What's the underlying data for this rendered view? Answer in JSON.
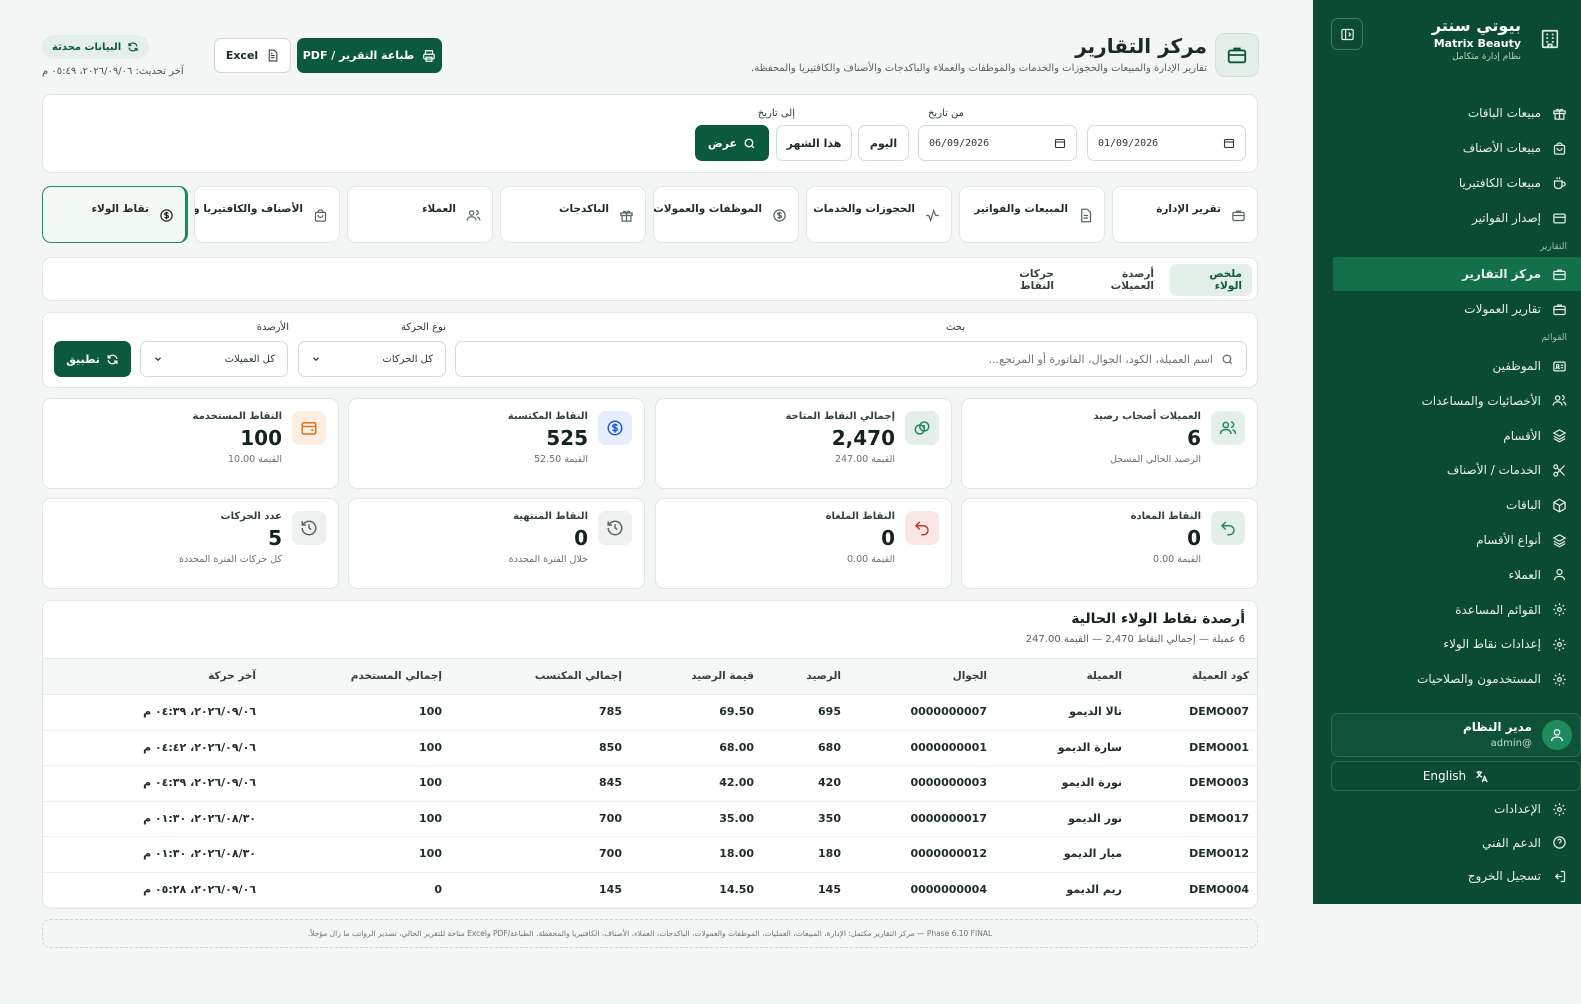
{
  "sidebar": {
    "brand_title": "بيوتي سنتر",
    "brand_name": "Matrix Beauty",
    "brand_tagline": "نظام إدارة متكامل",
    "items_top": [
      {
        "label": "مبيعات الباقات",
        "icon": "gift-icon"
      },
      {
        "label": "مبيعات الأصناف",
        "icon": "bag-icon"
      },
      {
        "label": "مبيعات الكافتيريا",
        "icon": "cup-icon"
      },
      {
        "label": "إصدار الفواتير",
        "icon": "card-icon"
      }
    ],
    "section_reports": "التقارير",
    "items_reports": [
      {
        "label": "مركز التقارير",
        "icon": "briefcase-icon",
        "active": true
      },
      {
        "label": "تقارير العمولات",
        "icon": "briefcase-icon"
      }
    ],
    "section_lists": "القوائم",
    "items_lists": [
      {
        "label": "الموظفين",
        "icon": "id-card-icon"
      },
      {
        "label": "الأخصائيات والمساعدات",
        "icon": "users-icon"
      },
      {
        "label": "الأقسام",
        "icon": "layers-icon"
      },
      {
        "label": "الخدمات / الأصناف",
        "icon": "scissors-icon"
      },
      {
        "label": "الباقات",
        "icon": "box-icon"
      },
      {
        "label": "أنواع الأقسام",
        "icon": "layers-icon"
      },
      {
        "label": "العملاء",
        "icon": "user-icon"
      },
      {
        "label": "القوائم المساعدة",
        "icon": "gear-icon"
      },
      {
        "label": "إعدادات نقاط الولاء",
        "icon": "gear-icon"
      },
      {
        "label": "المستخدمون والصلاحيات",
        "icon": "gear-icon"
      }
    ],
    "user_name": "مدير النظام",
    "user_handle": "@admin",
    "language_label": "English",
    "items_bottom": [
      {
        "label": "الإعدادات",
        "icon": "gear-icon"
      },
      {
        "label": "الدعم الفني",
        "icon": "help-icon"
      },
      {
        "label": "تسجيل الخروج",
        "icon": "logout-icon"
      }
    ]
  },
  "header": {
    "title": "مركز التقارير",
    "subtitle": "تقارير الإدارة والمبيعات والحجوزات والخدمات والموظفات والعملاء والباكدجات والأصناف والكافتيريا والمحفظة.",
    "print_button": "طباعة التقرير / PDF",
    "excel_button": "Excel",
    "updated_badge": "البيانات محدثة",
    "last_update": "آخر تحديث: ٢٠٢٦/٠٩/٠٦، ٠٥:٤٩ م"
  },
  "filters": {
    "from_label": "من تاريخ",
    "from_value": "01/09/2026",
    "to_label": "إلى تاريخ",
    "to_value": "06/09/2026",
    "today_button": "اليوم",
    "month_button": "هذا الشهر",
    "show_button": "عرض"
  },
  "report_tabs": [
    {
      "label": "تقرير الإدارة",
      "icon": "briefcase-icon"
    },
    {
      "label": "المبيعات والفواتير",
      "icon": "document-icon"
    },
    {
      "label": "الحجوزات والخدمات",
      "icon": "activity-icon"
    },
    {
      "label": "الموظفات والعمولات",
      "icon": "dollar-icon"
    },
    {
      "label": "الباكدجات",
      "icon": "gift-icon"
    },
    {
      "label": "العملاء",
      "icon": "users-icon"
    },
    {
      "label": "الأصناف والكافتيريا والمحفظة",
      "icon": "bag-icon"
    },
    {
      "label": "نقاط الولاء",
      "icon": "dollar-icon",
      "active": true
    }
  ],
  "sub_tabs": [
    {
      "label": "ملخص الولاء",
      "active": true
    },
    {
      "label": "أرصدة العميلات"
    },
    {
      "label": "حركات النقاط"
    }
  ],
  "search": {
    "search_label": "بحث",
    "search_placeholder": "اسم العميلة، الكود، الجوال، الفاتورة أو المرتجع...",
    "movement_label": "نوع الحركة",
    "movement_value": "كل الحركات",
    "balance_label": "الأرصدة",
    "balance_value": "كل العميلات",
    "apply_button": "تطبيق"
  },
  "stats": [
    {
      "title": "العميلات أصحاب رصيد",
      "value": "6",
      "note": "الرصيد الحالي المسجل",
      "icon": "users-icon",
      "accent": "#1f8a5c"
    },
    {
      "title": "إجمالي النقاط المتاحة",
      "value": "2,470",
      "note": "القيمة 247.00",
      "icon": "coins-icon",
      "accent": "#1f8a5c"
    },
    {
      "title": "النقاط المكتسبة",
      "value": "525",
      "note": "القيمة 52.50",
      "icon": "dollar-icon",
      "accent": "#1d5fd1"
    },
    {
      "title": "النقاط المستخدمة",
      "value": "100",
      "note": "القيمة 10.00",
      "icon": "wallet-icon",
      "accent": "#d9731c"
    },
    {
      "title": "النقاط المعادة",
      "value": "0",
      "note": "القيمة 0.00",
      "icon": "undo-icon",
      "accent": "#1f8a5c"
    },
    {
      "title": "النقاط الملغاة",
      "value": "0",
      "note": "القيمة 0.00",
      "icon": "undo-icon",
      "accent": "#c0392b"
    },
    {
      "title": "النقاط المنتهية",
      "value": "0",
      "note": "خلال الفترة المحددة",
      "icon": "history-icon",
      "accent": "#5b6761"
    },
    {
      "title": "عدد الحركات",
      "value": "5",
      "note": "كل حركات الفترة المحددة",
      "icon": "history-icon",
      "accent": "#5b6761"
    }
  ],
  "table": {
    "title": "أرصدة نقاط الولاء الحالية",
    "subtitle": "6 عميلة — إجمالي النقاط 2,470 — القيمة 247.00",
    "columns": [
      "كود العميلة",
      "العميلة",
      "الجوال",
      "الرصيد",
      "قيمة الرصيد",
      "إجمالي المكتسب",
      "إجمالي المستخدم",
      "آخر حركة"
    ],
    "rows": [
      [
        "DEMO007",
        "تالا الديمو",
        "0000000007",
        "695",
        "69.50",
        "785",
        "100",
        "٢٠٢٦/٠٩/٠٦، ٠٤:٣٩ م"
      ],
      [
        "DEMO001",
        "سارة الديمو",
        "0000000001",
        "680",
        "68.00",
        "850",
        "100",
        "٢٠٢٦/٠٩/٠٦، ٠٤:٤٢ م"
      ],
      [
        "DEMO003",
        "نورة الديمو",
        "0000000003",
        "420",
        "42.00",
        "845",
        "100",
        "٢٠٢٦/٠٩/٠٦، ٠٤:٣٩ م"
      ],
      [
        "DEMO017",
        "نور الديمو",
        "0000000017",
        "350",
        "35.00",
        "700",
        "100",
        "٢٠٢٦/٠٨/٣٠، ٠١:٣٠ م"
      ],
      [
        "DEMO012",
        "ميار الديمو",
        "0000000012",
        "180",
        "18.00",
        "700",
        "100",
        "٢٠٢٦/٠٨/٣٠، ٠١:٣٠ م"
      ],
      [
        "DEMO004",
        "ريم الديمو",
        "0000000004",
        "145",
        "14.50",
        "145",
        "0",
        "٢٠٢٦/٠٩/٠٦، ٠٥:٢٨ م"
      ]
    ]
  },
  "footer_note": "Phase 6.10 FINAL — مركز التقارير مكتمل: الإدارة، المبيعات، العمليات، الموظفات والعمولات، الباكدجات، العملاء، الأصناف، الكافتيريا والمحفظة. الطباعة/PDF وExcel متاحة للتقرير الحالي، تصدير الرواتب ما زال مؤجلاً."
}
